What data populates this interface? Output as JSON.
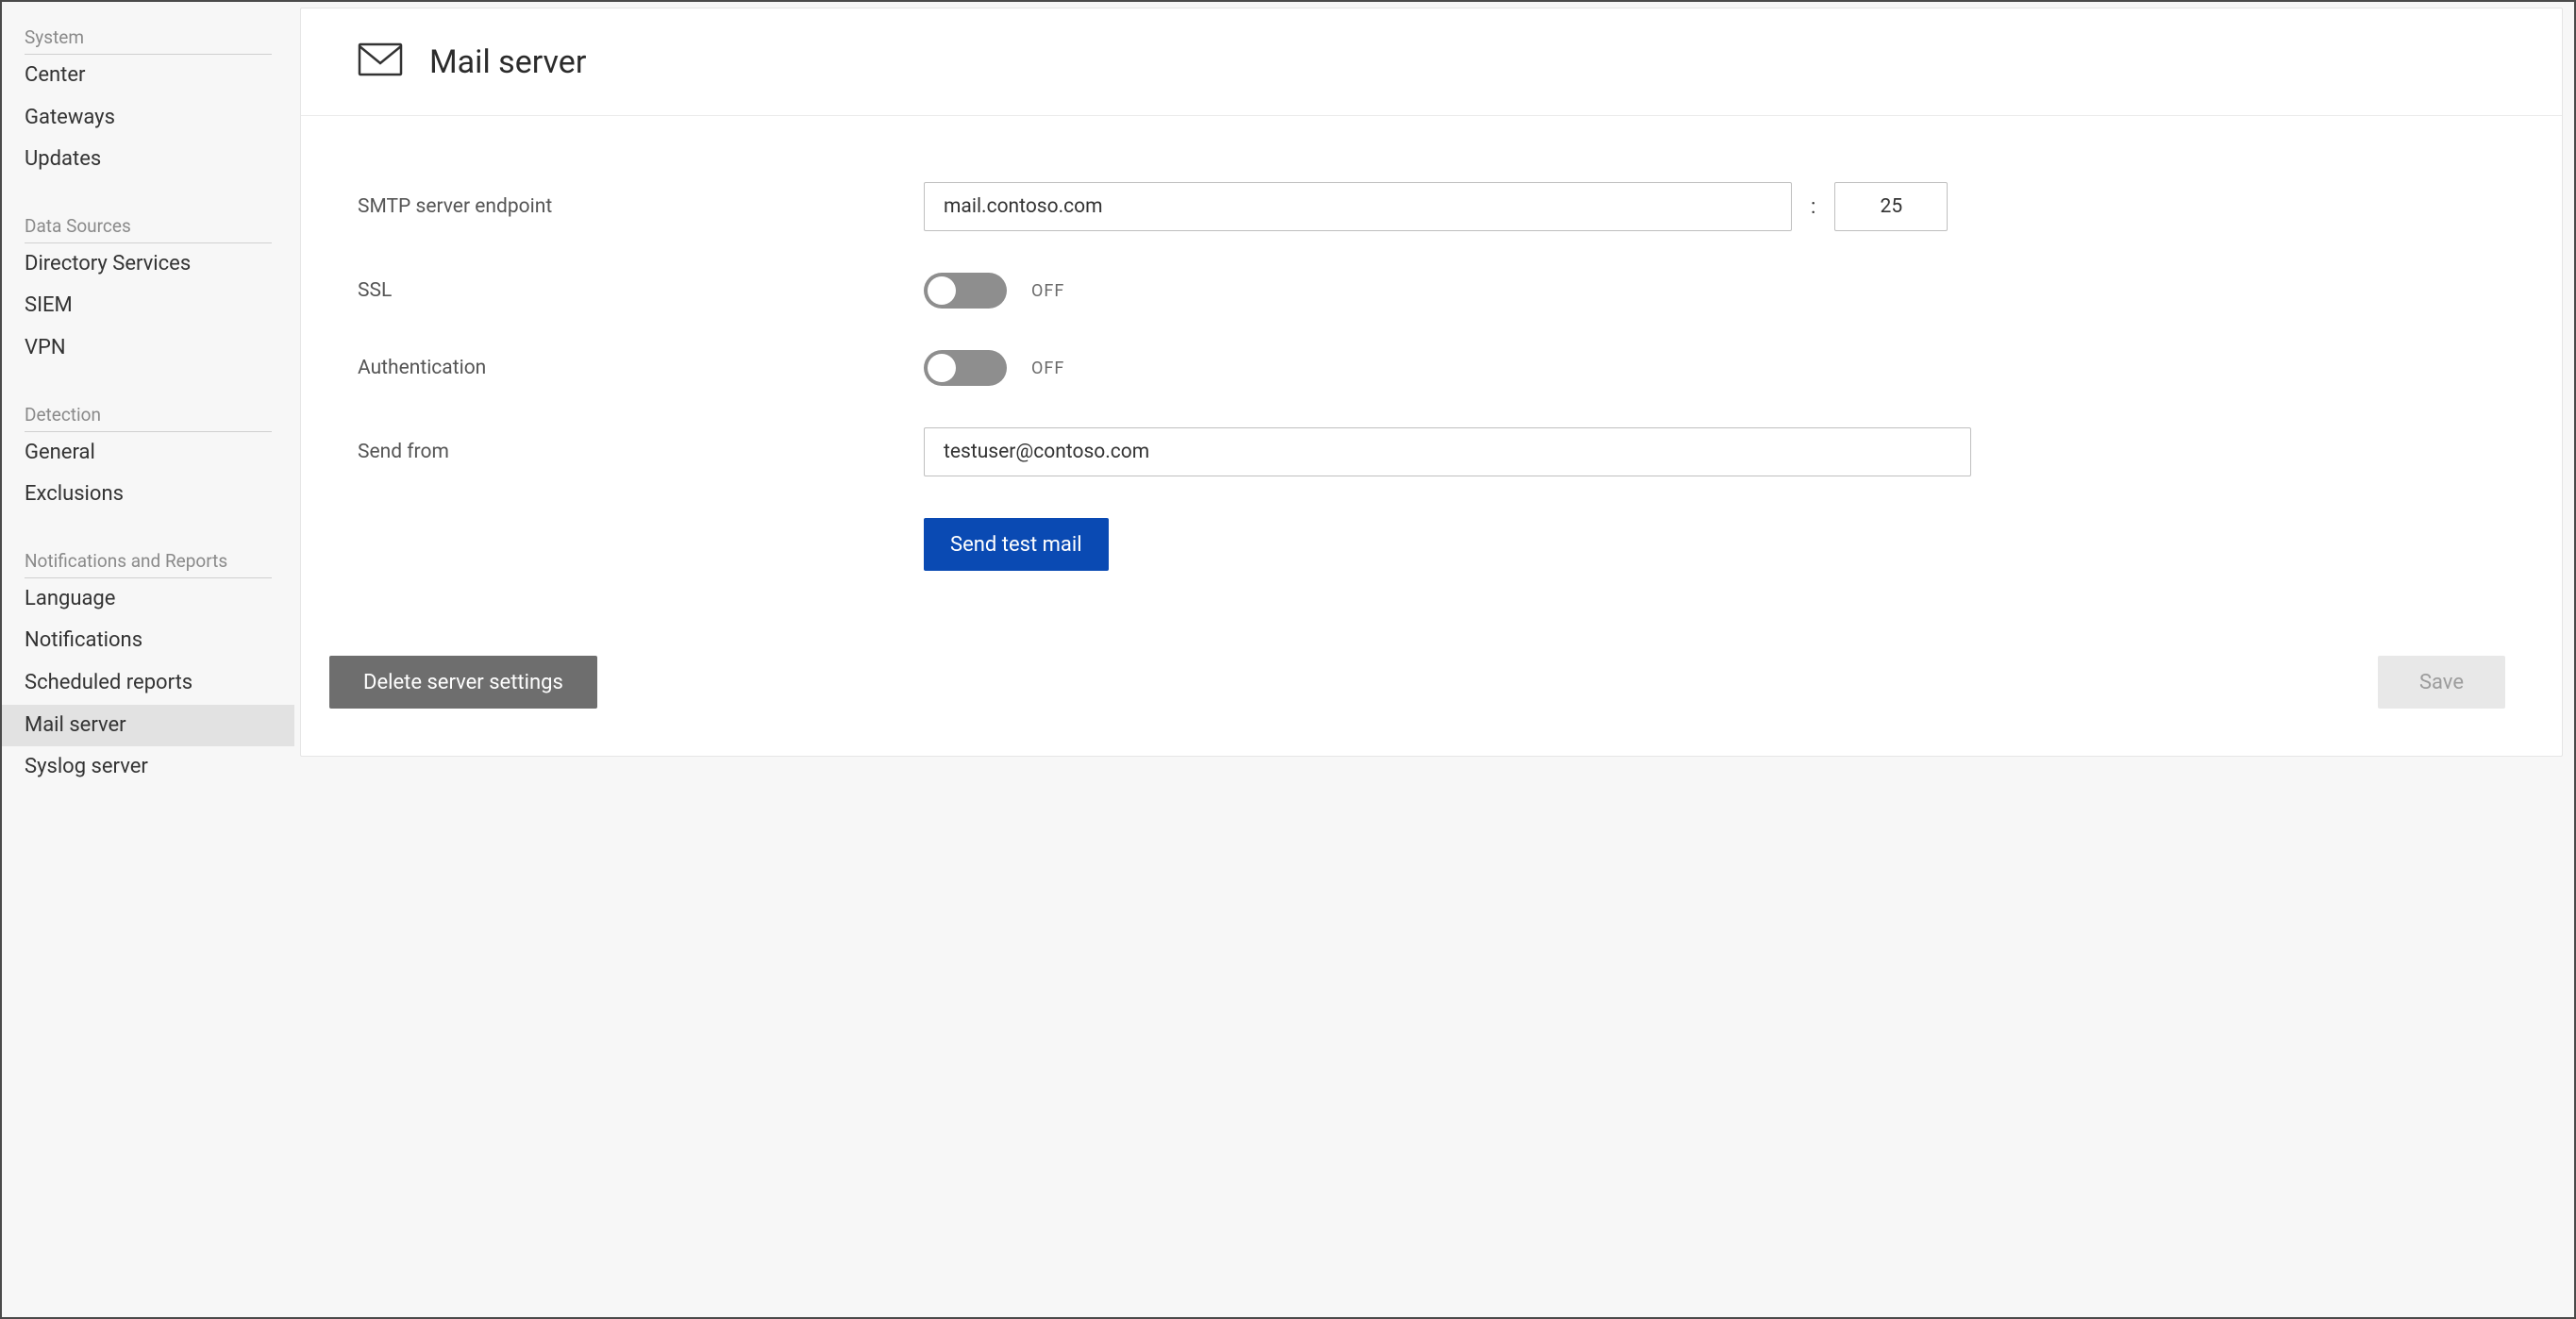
{
  "sidebar": {
    "sections": [
      {
        "header": "System",
        "items": [
          {
            "label": "Center",
            "active": false
          },
          {
            "label": "Gateways",
            "active": false
          },
          {
            "label": "Updates",
            "active": false
          }
        ]
      },
      {
        "header": "Data Sources",
        "items": [
          {
            "label": "Directory Services",
            "active": false
          },
          {
            "label": "SIEM",
            "active": false
          },
          {
            "label": "VPN",
            "active": false
          }
        ]
      },
      {
        "header": "Detection",
        "items": [
          {
            "label": "General",
            "active": false
          },
          {
            "label": "Exclusions",
            "active": false
          }
        ]
      },
      {
        "header": "Notifications and Reports",
        "items": [
          {
            "label": "Language",
            "active": false
          },
          {
            "label": "Notifications",
            "active": false
          },
          {
            "label": "Scheduled reports",
            "active": false
          },
          {
            "label": "Mail server",
            "active": true
          },
          {
            "label": "Syslog server",
            "active": false
          }
        ]
      }
    ]
  },
  "page": {
    "title": "Mail server",
    "fields": {
      "smtp_endpoint_label": "SMTP server endpoint",
      "smtp_host_value": "mail.contoso.com",
      "smtp_port_value": "25",
      "ssl_label": "SSL",
      "ssl_state": "OFF",
      "auth_label": "Authentication",
      "auth_state": "OFF",
      "send_from_label": "Send from",
      "send_from_value": "testuser@contoso.com"
    },
    "buttons": {
      "send_test": "Send test mail",
      "delete_settings": "Delete server settings",
      "save": "Save"
    },
    "colon": ":"
  }
}
